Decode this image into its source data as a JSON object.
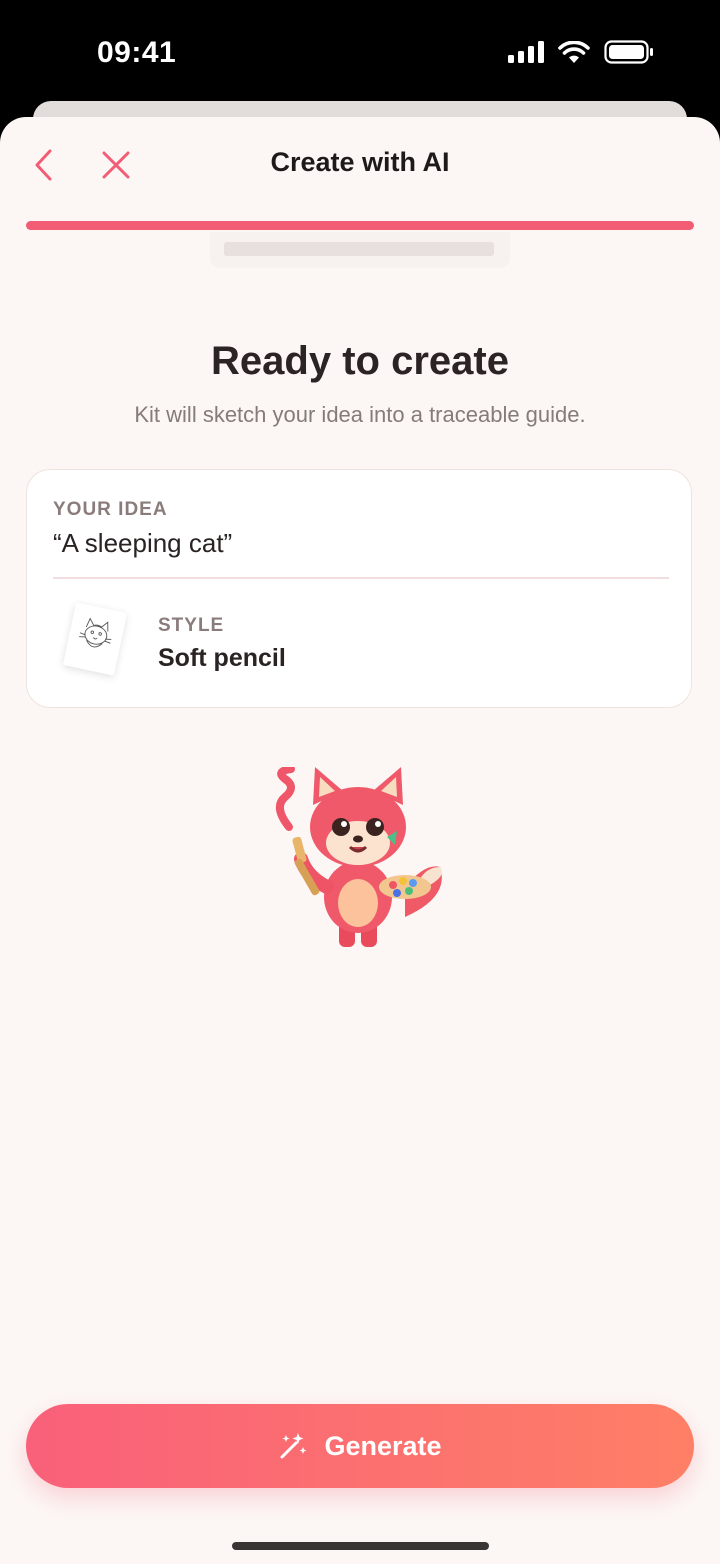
{
  "status_bar": {
    "time": "09:41"
  },
  "nav": {
    "title": "Create with AI",
    "back_icon": "chevron-left-icon",
    "close_icon": "close-icon"
  },
  "progress": {
    "value": 1.0,
    "color": "#f25d75"
  },
  "header": {
    "title": "Ready to create",
    "subtitle": "Kit will sketch your idea into a traceable guide."
  },
  "summary": {
    "idea_label": "YOUR IDEA",
    "idea_value": "“A sleeping cat”",
    "style_label": "STYLE",
    "style_value": "Soft pencil",
    "style_icon": "cat-sketch-thumbnail"
  },
  "mascot": {
    "icon": "fox-painter-mascot"
  },
  "generate_button": {
    "label": "Generate",
    "icon": "magic-wand-icon"
  },
  "colors": {
    "accent": "#f25d75",
    "gradient_start": "#f9607a",
    "gradient_end": "#fe7f66",
    "background": "#fcf7f5"
  }
}
